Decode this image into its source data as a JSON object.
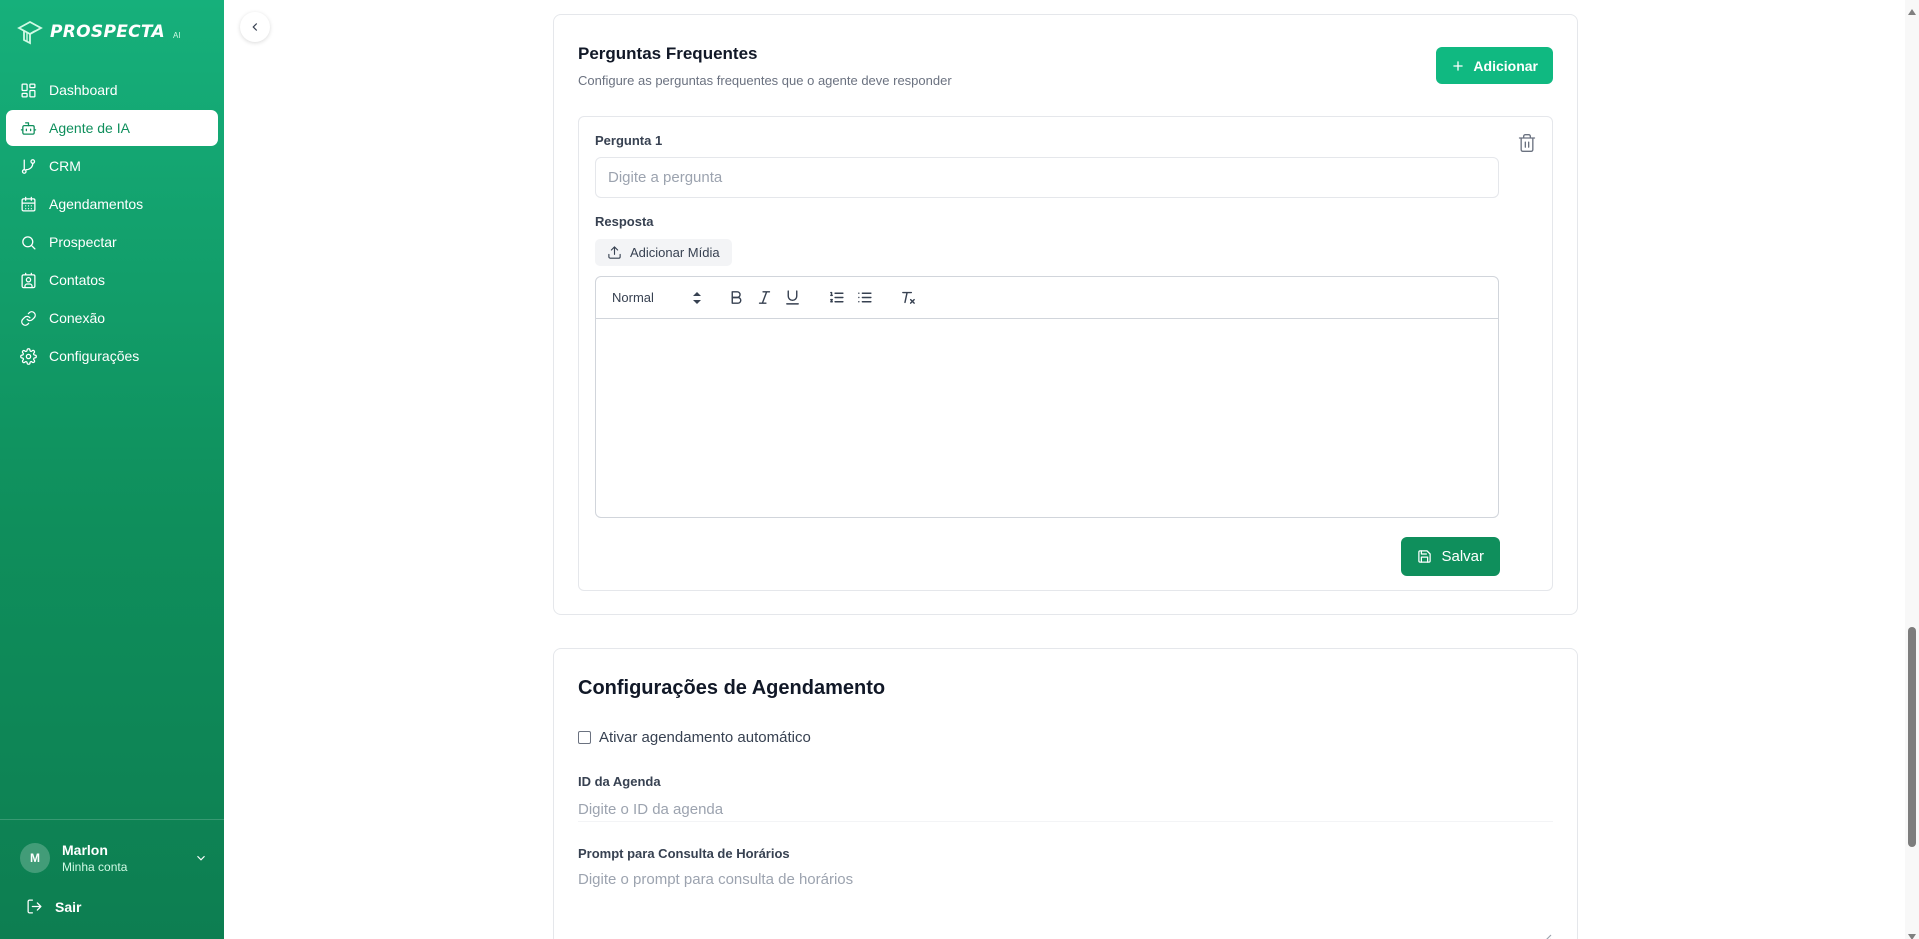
{
  "brand": {
    "name": "PROSPECTA",
    "suffix": "AI"
  },
  "sidebar": {
    "items": [
      {
        "label": "Dashboard",
        "icon": "dashboard-icon",
        "active": false
      },
      {
        "label": "Agente de IA",
        "icon": "bot-icon",
        "active": true
      },
      {
        "label": "CRM",
        "icon": "git-branch-icon",
        "active": false
      },
      {
        "label": "Agendamentos",
        "icon": "calendar-icon",
        "active": false
      },
      {
        "label": "Prospectar",
        "icon": "search-icon",
        "active": false
      },
      {
        "label": "Contatos",
        "icon": "contact-icon",
        "active": false
      },
      {
        "label": "Conexão",
        "icon": "link-icon",
        "active": false
      },
      {
        "label": "Configurações",
        "icon": "gear-icon",
        "active": false
      }
    ],
    "user": {
      "initial": "M",
      "name": "Marlon",
      "subtitle": "Minha conta"
    },
    "logout_label": "Sair"
  },
  "faq": {
    "title": "Perguntas Frequentes",
    "subtitle": "Configure as perguntas frequentes que o agente deve responder",
    "add_label": "Adicionar",
    "question_label": "Pergunta 1",
    "question_value": "",
    "question_placeholder": "Digite a pergunta",
    "answer_label": "Resposta",
    "media_label": "Adicionar Mídia",
    "editor": {
      "format_value": "Normal"
    },
    "save_label": "Salvar"
  },
  "schedule": {
    "title": "Configurações de Agendamento",
    "auto_label": "Ativar agendamento automático",
    "auto_checked": false,
    "agenda_id_label": "ID da Agenda",
    "agenda_id_placeholder": "Digite o ID da agenda",
    "prompt_label": "Prompt para Consulta de Horários",
    "prompt_placeholder": "Digite o prompt para consulta de horários"
  },
  "colors": {
    "brand_green": "#10b981",
    "brand_green_dark": "#0f8f5c",
    "sidebar_start": "#16b07b",
    "sidebar_end": "#0d7e51"
  }
}
